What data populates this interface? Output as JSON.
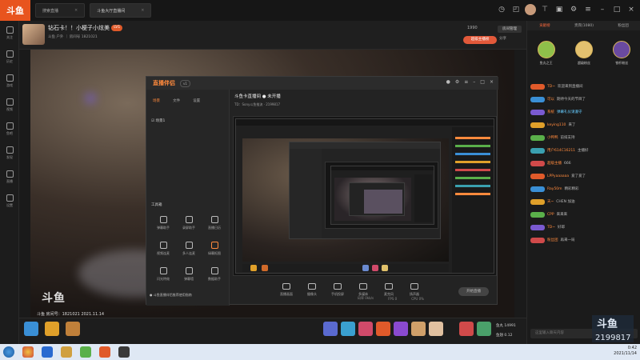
{
  "app": {
    "logo": "斗鱼"
  },
  "tabs": [
    {
      "label": "搜索直播",
      "close": "×"
    },
    {
      "label": "斗鱼大厅直播间",
      "close": "×"
    }
  ],
  "sidebar": [
    "关注",
    "历史",
    "游戏",
    "视频",
    "鱼吧",
    "发现",
    "直播",
    "设置"
  ],
  "room": {
    "title": "钻石卡！！小梗子小炫美",
    "meta": "斗鱼 户外 ｜ 房间号 1821021",
    "level": "LV1",
    "follow": "1990",
    "report": "房间管理",
    "hot": "超级主播榜",
    "share": "分享"
  },
  "video": {
    "signature": "斗鱼",
    "stamp": "斗鱼 房间号：1821021 2021.11.14"
  },
  "obs": {
    "logo": "直播伴侣",
    "version": "v1",
    "tabs": [
      "场景",
      "文件",
      "设置"
    ],
    "scene": "☑ 场景1",
    "tools_title": "工具箱",
    "tools": [
      "弹幕助手",
      "录屏助手",
      "直播日历",
      "视频连麦",
      "多人连麦",
      "绿幕抠图",
      "闪光特效",
      "弹幕墙",
      "数据助手"
    ],
    "bottom_tip": "● 斗鱼直播伴侣推荐使用指南",
    "right_title": "斗鱼卡直播间 ● 未开播",
    "right_sub": "TD：Sony斗鱼推流 · 2199817",
    "buttons": [
      "直播画面",
      "摄像头",
      "手机投屏",
      "多媒体",
      "麦克风",
      "扬声器"
    ],
    "start": "开始直播",
    "status": [
      "码率 0kb/s",
      "FPS 0",
      "CPU 0%"
    ]
  },
  "gifts": {
    "balance": "鱼丸 14991",
    "balance2": "鱼翅 0.12"
  },
  "chat": {
    "tabs": [
      "贡献榜",
      "贵宾(1080)",
      "粉丝团"
    ],
    "top3": [
      {
        "name": "鱼丸之王",
        "color": "#8fc04a"
      },
      {
        "name": "超级粉丝",
        "color": "#e3c16f"
      },
      {
        "name": "铁杆粉丝",
        "color": "#6a4aa0"
      }
    ],
    "messages": [
      {
        "user": "TD~",
        "text": "欢迎来到直播间",
        "lv": "#e05a2a"
      },
      {
        "user": "可以",
        "text": "期待今天的节目了",
        "lv": "#3a8fd6"
      },
      {
        "user": "系统",
        "text": "弹幕礼仪请遵守",
        "lv": "#7a5ad0"
      },
      {
        "user": "keying110",
        "text": "来了",
        "lv": "#e0a02a"
      },
      {
        "user": "小鸭鸭",
        "text": "前排支持",
        "lv": "#5ab04a"
      },
      {
        "user": "用户614C16211",
        "text": "主播好",
        "lv": "#3aa0b0"
      },
      {
        "user": "超级主播",
        "text": "666",
        "lv": "#d04a4a"
      },
      {
        "user": "LPPyaaaaaa",
        "text": "爱了爱了",
        "lv": "#e05a2a"
      },
      {
        "user": "Ray50m",
        "text": "精彩精彩",
        "lv": "#3a8fd6"
      },
      {
        "user": "天~",
        "text": "CHEN 加油",
        "lv": "#e0a02a"
      },
      {
        "user": "CPP",
        "text": "来来来",
        "lv": "#5ab04a"
      },
      {
        "user": "TD~",
        "text": "好耶",
        "lv": "#7a5ad0"
      },
      {
        "user": "粉丝团",
        "text": "再来一局",
        "lv": "#d04a4a"
      }
    ],
    "input_placeholder": "这里输入聊天内容",
    "room_number": "2199817"
  },
  "taskbar": {
    "time": "0:42",
    "date": "2021/11/14"
  }
}
